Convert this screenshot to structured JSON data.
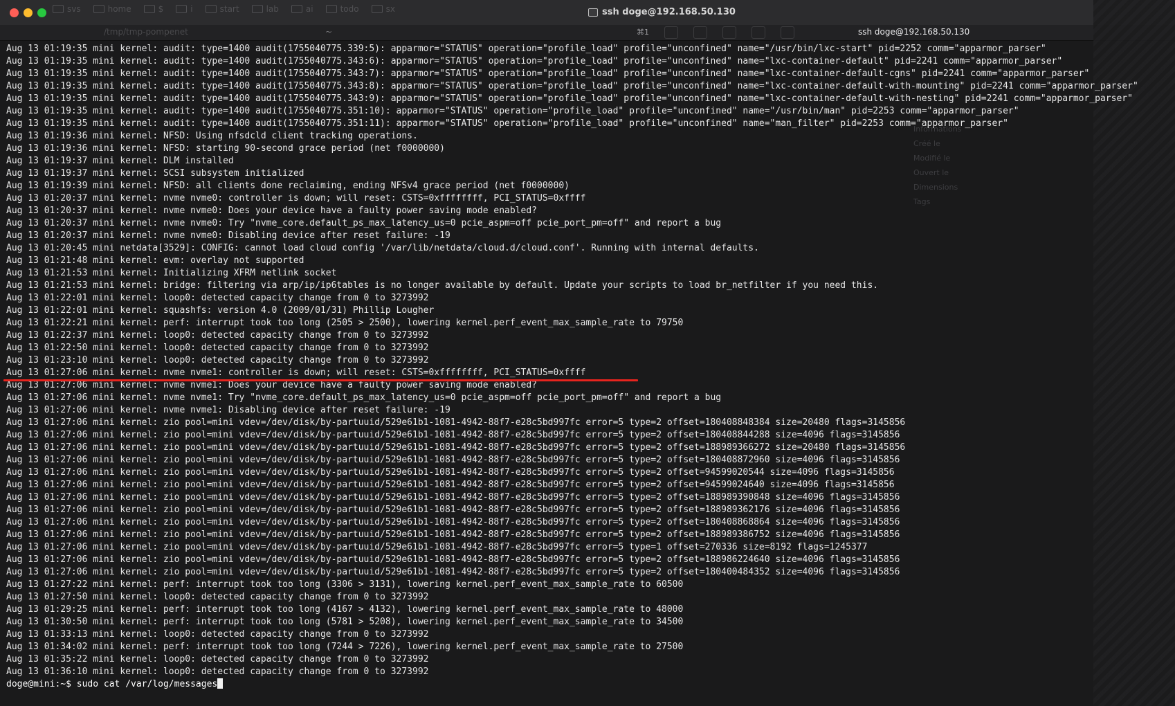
{
  "window": {
    "title": "ssh doge@192.168.50.130",
    "tab_title": "ssh doge@192.168.50.130",
    "tab_cwd": "/tmp/tmp-pompenet",
    "tab_tilde": "~",
    "tab_shortcut": "⌘1"
  },
  "bookmarks": [
    "svs",
    "home",
    "$",
    "i",
    "start",
    "lab",
    "ai",
    "todo",
    "sx"
  ],
  "accent_color": "#e8241e",
  "log_lines": [
    "Aug 13 01:19:35 mini kernel: audit: type=1400 audit(1755040775.339:5): apparmor=\"STATUS\" operation=\"profile_load\" profile=\"unconfined\" name=\"/usr/bin/lxc-start\" pid=2252 comm=\"apparmor_parser\"",
    "Aug 13 01:19:35 mini kernel: audit: type=1400 audit(1755040775.343:6): apparmor=\"STATUS\" operation=\"profile_load\" profile=\"unconfined\" name=\"lxc-container-default\" pid=2241 comm=\"apparmor_parser\"",
    "Aug 13 01:19:35 mini kernel: audit: type=1400 audit(1755040775.343:7): apparmor=\"STATUS\" operation=\"profile_load\" profile=\"unconfined\" name=\"lxc-container-default-cgns\" pid=2241 comm=\"apparmor_parser\"",
    "Aug 13 01:19:35 mini kernel: audit: type=1400 audit(1755040775.343:8): apparmor=\"STATUS\" operation=\"profile_load\" profile=\"unconfined\" name=\"lxc-container-default-with-mounting\" pid=2241 comm=\"apparmor_parser\"",
    "Aug 13 01:19:35 mini kernel: audit: type=1400 audit(1755040775.343:9): apparmor=\"STATUS\" operation=\"profile_load\" profile=\"unconfined\" name=\"lxc-container-default-with-nesting\" pid=2241 comm=\"apparmor_parser\"",
    "Aug 13 01:19:35 mini kernel: audit: type=1400 audit(1755040775.351:10): apparmor=\"STATUS\" operation=\"profile_load\" profile=\"unconfined\" name=\"/usr/bin/man\" pid=2253 comm=\"apparmor_parser\"",
    "Aug 13 01:19:35 mini kernel: audit: type=1400 audit(1755040775.351:11): apparmor=\"STATUS\" operation=\"profile_load\" profile=\"unconfined\" name=\"man_filter\" pid=2253 comm=\"apparmor_parser\"",
    "Aug 13 01:19:36 mini kernel: NFSD: Using nfsdcld client tracking operations.",
    "Aug 13 01:19:36 mini kernel: NFSD: starting 90-second grace period (net f0000000)",
    "Aug 13 01:19:37 mini kernel: DLM installed",
    "Aug 13 01:19:37 mini kernel: SCSI subsystem initialized",
    "Aug 13 01:19:39 mini kernel: NFSD: all clients done reclaiming, ending NFSv4 grace period (net f0000000)",
    "Aug 13 01:20:37 mini kernel: nvme nvme0: controller is down; will reset: CSTS=0xffffffff, PCI_STATUS=0xffff",
    "Aug 13 01:20:37 mini kernel: nvme nvme0: Does your device have a faulty power saving mode enabled?",
    "Aug 13 01:20:37 mini kernel: nvme nvme0: Try \"nvme_core.default_ps_max_latency_us=0 pcie_aspm=off pcie_port_pm=off\" and report a bug",
    "Aug 13 01:20:37 mini kernel: nvme nvme0: Disabling device after reset failure: -19",
    "Aug 13 01:20:45 mini netdata[3529]: CONFIG: cannot load cloud config '/var/lib/netdata/cloud.d/cloud.conf'. Running with internal defaults.",
    "Aug 13 01:21:48 mini kernel: evm: overlay not supported",
    "Aug 13 01:21:53 mini kernel: Initializing XFRM netlink socket",
    "Aug 13 01:21:53 mini kernel: bridge: filtering via arp/ip/ip6tables is no longer available by default. Update your scripts to load br_netfilter if you need this.",
    "Aug 13 01:22:01 mini kernel: loop0: detected capacity change from 0 to 3273992",
    "Aug 13 01:22:01 mini kernel: squashfs: version 4.0 (2009/01/31) Phillip Lougher",
    "Aug 13 01:22:21 mini kernel: perf: interrupt took too long (2505 > 2500), lowering kernel.perf_event_max_sample_rate to 79750",
    "Aug 13 01:22:37 mini kernel: loop0: detected capacity change from 0 to 3273992",
    "Aug 13 01:22:50 mini kernel: loop0: detected capacity change from 0 to 3273992",
    "Aug 13 01:23:10 mini kernel: loop0: detected capacity change from 0 to 3273992",
    "Aug 13 01:27:06 mini kernel: nvme nvme1: controller is down; will reset: CSTS=0xffffffff, PCI_STATUS=0xffff",
    "Aug 13 01:27:06 mini kernel: nvme nvme1: Does your device have a faulty power saving mode enabled?",
    "Aug 13 01:27:06 mini kernel: nvme nvme1: Try \"nvme_core.default_ps_max_latency_us=0 pcie_aspm=off pcie_port_pm=off\" and report a bug",
    "Aug 13 01:27:06 mini kernel: nvme nvme1: Disabling device after reset failure: -19",
    "Aug 13 01:27:06 mini kernel: zio pool=mini vdev=/dev/disk/by-partuuid/529e61b1-1081-4942-88f7-e28c5bd997fc error=5 type=2 offset=180408848384 size=20480 flags=3145856",
    "Aug 13 01:27:06 mini kernel: zio pool=mini vdev=/dev/disk/by-partuuid/529e61b1-1081-4942-88f7-e28c5bd997fc error=5 type=2 offset=180408844288 size=4096 flags=3145856",
    "Aug 13 01:27:06 mini kernel: zio pool=mini vdev=/dev/disk/by-partuuid/529e61b1-1081-4942-88f7-e28c5bd997fc error=5 type=2 offset=188989366272 size=20480 flags=3145856",
    "Aug 13 01:27:06 mini kernel: zio pool=mini vdev=/dev/disk/by-partuuid/529e61b1-1081-4942-88f7-e28c5bd997fc error=5 type=2 offset=180408872960 size=4096 flags=3145856",
    "Aug 13 01:27:06 mini kernel: zio pool=mini vdev=/dev/disk/by-partuuid/529e61b1-1081-4942-88f7-e28c5bd997fc error=5 type=2 offset=94599020544 size=4096 flags=3145856",
    "Aug 13 01:27:06 mini kernel: zio pool=mini vdev=/dev/disk/by-partuuid/529e61b1-1081-4942-88f7-e28c5bd997fc error=5 type=2 offset=94599024640 size=4096 flags=3145856",
    "Aug 13 01:27:06 mini kernel: zio pool=mini vdev=/dev/disk/by-partuuid/529e61b1-1081-4942-88f7-e28c5bd997fc error=5 type=2 offset=188989390848 size=4096 flags=3145856",
    "Aug 13 01:27:06 mini kernel: zio pool=mini vdev=/dev/disk/by-partuuid/529e61b1-1081-4942-88f7-e28c5bd997fc error=5 type=2 offset=188989362176 size=4096 flags=3145856",
    "Aug 13 01:27:06 mini kernel: zio pool=mini vdev=/dev/disk/by-partuuid/529e61b1-1081-4942-88f7-e28c5bd997fc error=5 type=2 offset=180408868864 size=4096 flags=3145856",
    "Aug 13 01:27:06 mini kernel: zio pool=mini vdev=/dev/disk/by-partuuid/529e61b1-1081-4942-88f7-e28c5bd997fc error=5 type=2 offset=188989386752 size=4096 flags=3145856",
    "Aug 13 01:27:06 mini kernel: zio pool=mini vdev=/dev/disk/by-partuuid/529e61b1-1081-4942-88f7-e28c5bd997fc error=5 type=1 offset=270336 size=8192 flags=1245377",
    "Aug 13 01:27:06 mini kernel: zio pool=mini vdev=/dev/disk/by-partuuid/529e61b1-1081-4942-88f7-e28c5bd997fc error=5 type=2 offset=188986224640 size=4096 flags=3145856",
    "Aug 13 01:27:06 mini kernel: zio pool=mini vdev=/dev/disk/by-partuuid/529e61b1-1081-4942-88f7-e28c5bd997fc error=5 type=2 offset=180400484352 size=4096 flags=3145856",
    "Aug 13 01:27:22 mini kernel: perf: interrupt took too long (3306 > 3131), lowering kernel.perf_event_max_sample_rate to 60500",
    "Aug 13 01:27:50 mini kernel: loop0: detected capacity change from 0 to 3273992",
    "Aug 13 01:29:25 mini kernel: perf: interrupt took too long (4167 > 4132), lowering kernel.perf_event_max_sample_rate to 48000",
    "Aug 13 01:30:50 mini kernel: perf: interrupt took too long (5781 > 5208), lowering kernel.perf_event_max_sample_rate to 34500",
    "Aug 13 01:33:13 mini kernel: loop0: detected capacity change from 0 to 3273992",
    "Aug 13 01:34:02 mini kernel: perf: interrupt took too long (7244 > 7226), lowering kernel.perf_event_max_sample_rate to 27500",
    "Aug 13 01:35:22 mini kernel: loop0: detected capacity change from 0 to 3273992",
    "Aug 13 01:36:10 mini kernel: loop0: detected capacity change from 0 to 3273992"
  ],
  "prompt": {
    "user_host": "doge@mini:~$",
    "command": "sudo cat /var/log/messages"
  },
  "highlighted_line_index": 26,
  "ghost_panel": {
    "heading": "Informations",
    "rows": [
      "Créé le",
      "Modifié le",
      "Ouvert le",
      "Dimensions"
    ],
    "tags_heading": "Tags"
  }
}
